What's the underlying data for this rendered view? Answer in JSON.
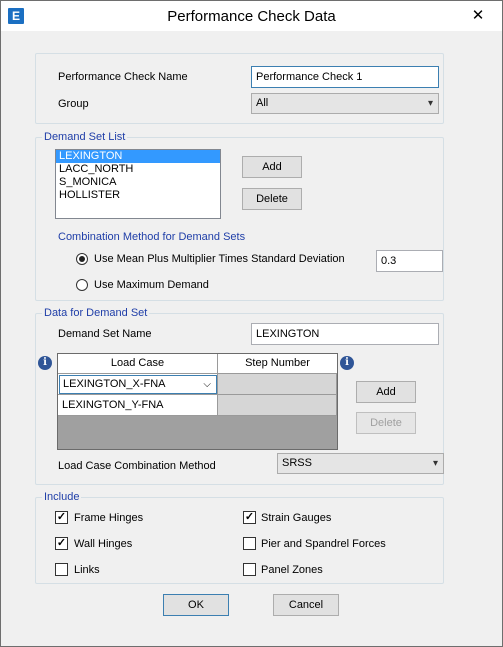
{
  "window": {
    "title": "Performance Check Data",
    "app_icon_letter": "E",
    "close_glyph": "✕"
  },
  "top": {
    "name_label": "Performance Check Name",
    "name_value": "Performance Check 1",
    "group_label": "Group",
    "group_value": "All"
  },
  "demand_set_list": {
    "legend": "Demand Set List",
    "items": [
      "LEXINGTON",
      "LACC_NORTH",
      "S_MONICA",
      "HOLLISTER"
    ],
    "selected_index": 0,
    "add_label": "Add",
    "delete_label": "Delete",
    "combination_heading": "Combination Method for Demand Sets",
    "option_mean_label": "Use Mean Plus Multiplier Times Standard Deviation",
    "option_mean_value": "0.3",
    "option_max_label": "Use Maximum Demand",
    "selected_option": "mean"
  },
  "demand_set_data": {
    "legend": "Data for Demand Set",
    "name_label": "Demand Set Name",
    "name_value": "LEXINGTON",
    "grid_headers": [
      "Load Case",
      "Step Number"
    ],
    "rows": [
      {
        "load_case": "LEXINGTON_X-FNA",
        "step": ""
      },
      {
        "load_case": "LEXINGTON_Y-FNA",
        "step": ""
      }
    ],
    "add_label": "Add",
    "delete_label": "Delete",
    "combination_label": "Load Case Combination Method",
    "combination_value": "SRSS",
    "info_glyph": "i"
  },
  "include": {
    "legend": "Include",
    "items": [
      {
        "label": "Frame Hinges",
        "checked": true
      },
      {
        "label": "Strain Gauges",
        "checked": true
      },
      {
        "label": "Wall Hinges",
        "checked": true
      },
      {
        "label": "Pier and Spandrel Forces",
        "checked": false
      },
      {
        "label": "Links",
        "checked": false
      },
      {
        "label": "Panel Zones",
        "checked": false
      }
    ]
  },
  "footer": {
    "ok_label": "OK",
    "cancel_label": "Cancel"
  },
  "colors": {
    "accent_text": "#1f3ea8",
    "selection": "#3399ff"
  }
}
